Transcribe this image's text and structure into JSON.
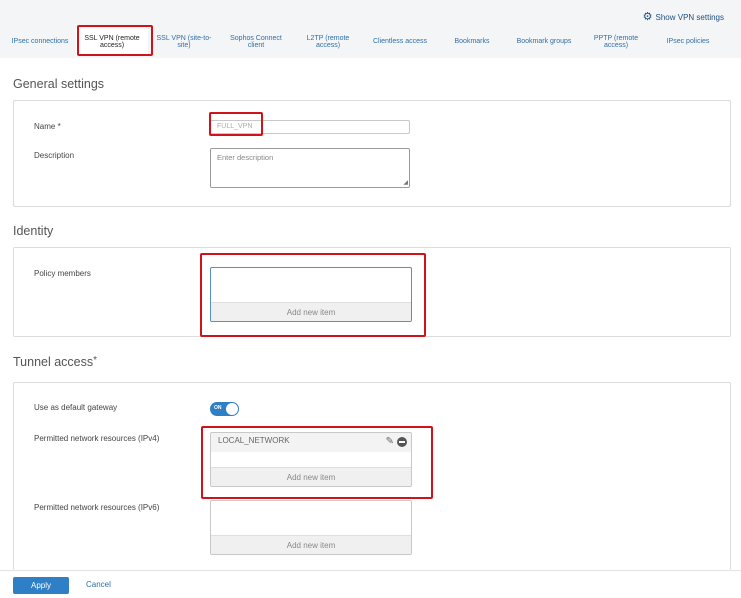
{
  "header": {
    "vpn_settings_label": "Show VPN settings",
    "vpn_settings_icon": "gear-icon"
  },
  "tabs": [
    {
      "label": "IPsec connections",
      "active": false
    },
    {
      "label": "SSL VPN (remote access)",
      "active": true
    },
    {
      "label": "SSL VPN (site-to-site)",
      "active": false
    },
    {
      "label": "Sophos Connect client",
      "active": false
    },
    {
      "label": "L2TP (remote access)",
      "active": false
    },
    {
      "label": "Clientless access",
      "active": false
    },
    {
      "label": "Bookmarks",
      "active": false
    },
    {
      "label": "Bookmark groups",
      "active": false
    },
    {
      "label": "PPTP (remote access)",
      "active": false
    },
    {
      "label": "IPsec policies",
      "active": false
    }
  ],
  "general": {
    "title": "General settings",
    "name_label": "Name *",
    "name_value": "FULL_VPN",
    "description_label": "Description",
    "description_placeholder": "Enter description"
  },
  "identity": {
    "title": "Identity",
    "policy_members_label": "Policy members",
    "add_new_item": "Add new item"
  },
  "tunnel": {
    "title": "Tunnel access",
    "title_marker": "*",
    "default_gateway_label": "Use as default gateway",
    "toggle_text": "ON",
    "toggle_on": true,
    "ipv4_label": "Permitted network resources (IPv4)",
    "ipv4_items": [
      "LOCAL_NETWORK"
    ],
    "ipv4_add": "Add new item",
    "ipv6_label": "Permitted network resources (IPv6)",
    "ipv6_add": "Add new item"
  },
  "footer": {
    "apply_label": "Apply",
    "cancel_label": "Cancel"
  },
  "colors": {
    "accent": "#2f7fc7",
    "link": "#2f6fa6",
    "highlight": "#d0121a"
  }
}
